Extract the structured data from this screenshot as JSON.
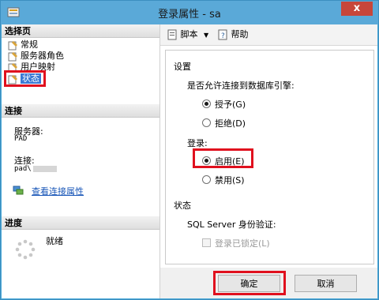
{
  "window": {
    "title": "登录属性 - sa",
    "close_glyph": "x"
  },
  "left_panel": {
    "select_page_header": "选择页",
    "pages": [
      {
        "label": "常规"
      },
      {
        "label": "服务器角色"
      },
      {
        "label": "用户映射"
      },
      {
        "label": "状态"
      }
    ],
    "connection": {
      "header": "连接",
      "server_label": "服务器:",
      "server_value": "PAD",
      "conn_label": "连接:",
      "conn_value": "pad\\",
      "view_props_link": "查看连接属性"
    },
    "progress": {
      "header": "进度",
      "status": "就绪"
    }
  },
  "toolbar": {
    "script_label": "脚本",
    "help_label": "帮助"
  },
  "settings": {
    "section_title": "设置",
    "allow_connect_question": "是否允许连接到数据库引擎:",
    "grant_label": "授予(G)",
    "deny_label": "拒绝(D)",
    "login_label": "登录:",
    "enable_label": "启用(E)",
    "disable_label": "禁用(S)",
    "status_title": "状态",
    "sql_auth_label": "SQL Server 身份验证:",
    "locked_label": "登录已锁定(L)"
  },
  "buttons": {
    "ok": "确定",
    "cancel": "取消"
  },
  "colors": {
    "highlight": "#e0101e",
    "selection": "#3b79d4",
    "titlebar": "#5aa9d8"
  }
}
